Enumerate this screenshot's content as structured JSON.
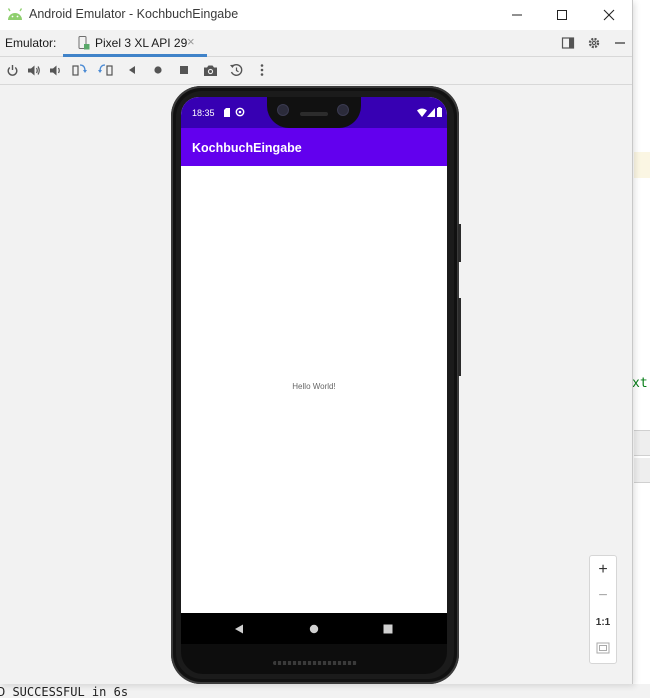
{
  "ide_background": {
    "code_fragment": "xt",
    "build_output": "D SUCCESSFUL in 6s"
  },
  "window": {
    "title": "Android Emulator - KochbuchEingabe",
    "controls": {
      "minimize": "—",
      "maximize": "☐",
      "close": "✕"
    }
  },
  "tabbar": {
    "label": "Emulator:",
    "tab_label": "Pixel 3 XL API 29",
    "tab_close": "×"
  },
  "toolbar": {
    "icons": [
      "power-icon",
      "volume-up-icon",
      "volume-down-icon",
      "rotate-left-icon",
      "rotate-right-icon",
      "back-icon",
      "home-icon",
      "overview-icon",
      "screenshot-icon",
      "snapshot-icon",
      "more-icon"
    ]
  },
  "device": {
    "status_time": "18:35",
    "app_title": "KochbuchEingabe",
    "content_text": "Hello World!",
    "colors": {
      "status_bar": "#3700b3",
      "app_bar": "#6200ee"
    }
  },
  "zoom": {
    "zoom_in": "+",
    "zoom_out": "−",
    "actual_size": "1:1"
  }
}
